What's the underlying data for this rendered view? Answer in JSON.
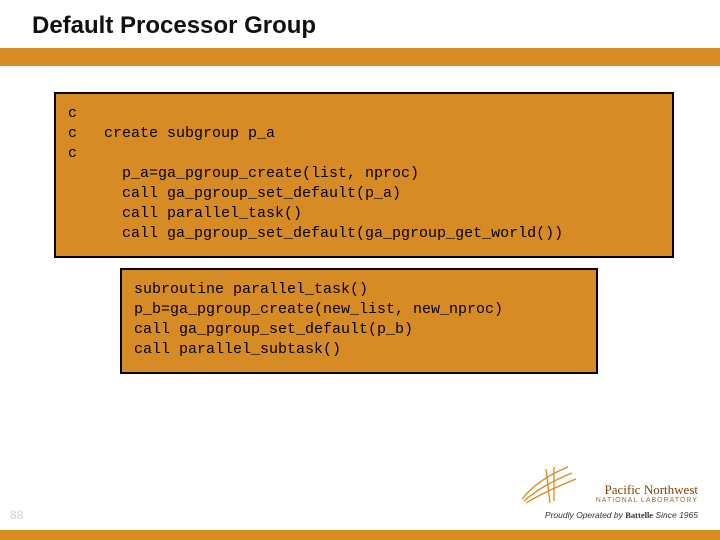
{
  "slide": {
    "title": "Default Processor Group",
    "number": "88"
  },
  "code1": {
    "l0": "c",
    "l1": "c   create subgroup p_a",
    "l2": "c",
    "l3": "      p_a=ga_pgroup_create(list, nproc)",
    "l4": "      call ga_pgroup_set_default(p_a)",
    "l5": "      call parallel_task()",
    "l6": "      call ga_pgroup_set_default(ga_pgroup_get_world())"
  },
  "code2": {
    "l0": "subroutine parallel_task()",
    "l1": "p_b=ga_pgroup_create(new_list, new_nproc)",
    "l2": "call ga_pgroup_set_default(p_b)",
    "l3": "call parallel_subtask()"
  },
  "branding": {
    "org_line1": "Pacific Northwest",
    "org_line2": "NATIONAL LABORATORY",
    "tagline_prefix": "Proudly Operated by ",
    "tagline_name": "Battelle",
    "tagline_suffix": " Since 1965"
  }
}
